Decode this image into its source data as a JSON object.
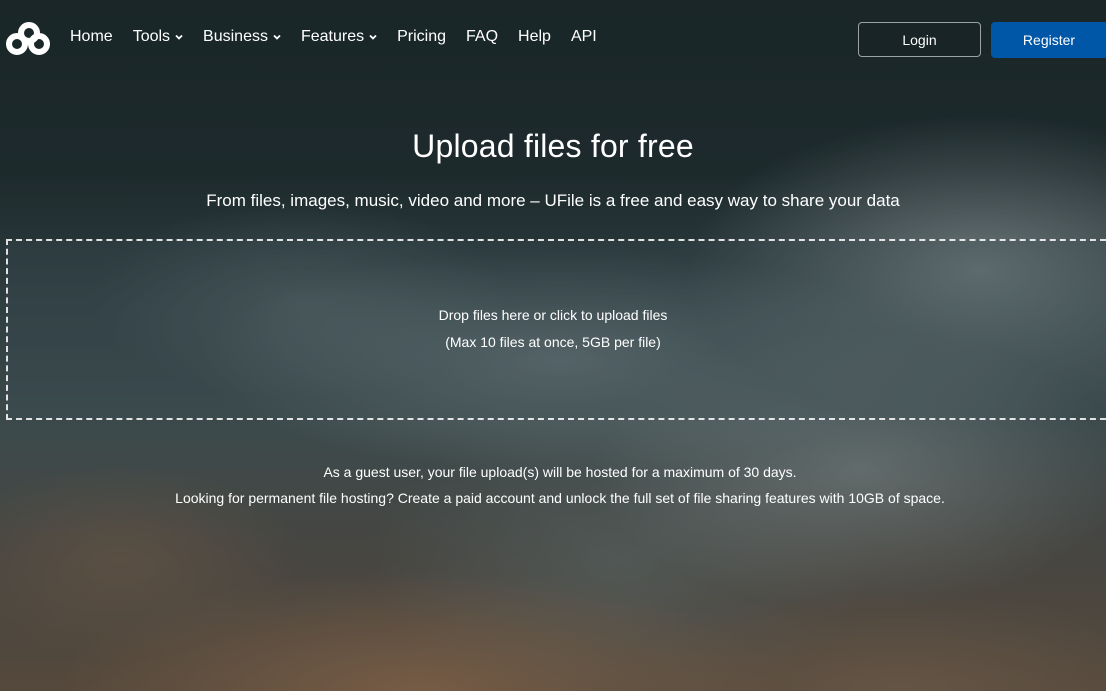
{
  "header": {
    "logo_icon": "ufile-logo-icon",
    "nav": [
      {
        "label": "Home",
        "has_dropdown": false
      },
      {
        "label": "Tools",
        "has_dropdown": true
      },
      {
        "label": "Business",
        "has_dropdown": true
      },
      {
        "label": "Features",
        "has_dropdown": true
      },
      {
        "label": "Pricing",
        "has_dropdown": false
      },
      {
        "label": "FAQ",
        "has_dropdown": false
      },
      {
        "label": "Help",
        "has_dropdown": false
      },
      {
        "label": "API",
        "has_dropdown": false
      }
    ],
    "login_label": "Login",
    "register_label": "Register",
    "register_color": "#0057a8"
  },
  "hero": {
    "title": "Upload files for free",
    "subtitle": "From files, images, music, video and more – UFile is a free and easy way to share your data"
  },
  "dropzone": {
    "line1": "Drop files here or click to upload files",
    "line2": "(Max 10 files at once, 5GB per file)"
  },
  "notes": {
    "guest": "As a guest user, your file upload(s) will be hosted for a maximum of 30 days.",
    "paid": "Looking for permanent file hosting? Create a paid account and unlock the full set of file sharing features with 10GB of space."
  }
}
